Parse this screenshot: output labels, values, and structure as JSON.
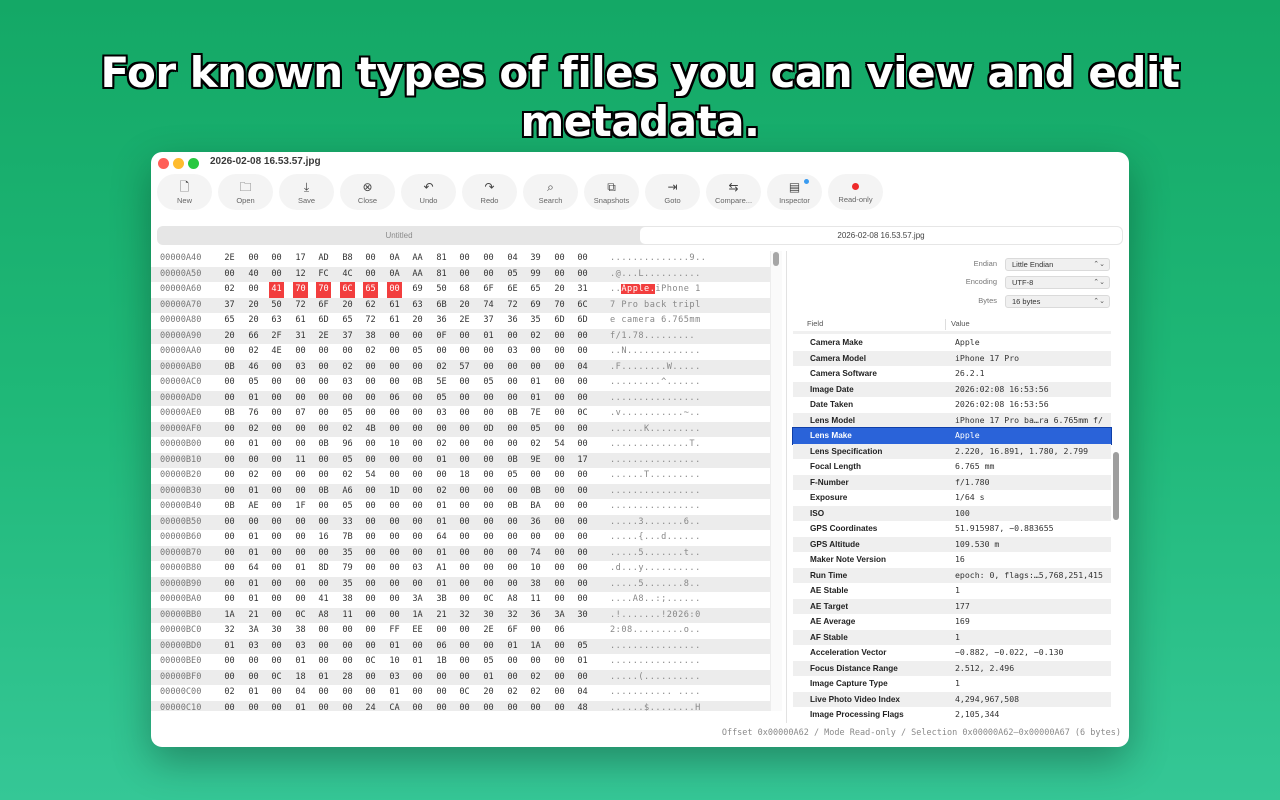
{
  "headline": "For known types of files you can view and edit metadata.",
  "window": {
    "title": "2026-02-08 16.53.57.jpg"
  },
  "toolbar": [
    {
      "label": "New",
      "icon": "new-file-icon"
    },
    {
      "label": "Open",
      "icon": "folder-icon"
    },
    {
      "label": "Save",
      "icon": "save-icon"
    },
    {
      "label": "Close",
      "icon": "close-circle-icon"
    },
    {
      "label": "Undo",
      "icon": "undo-icon"
    },
    {
      "label": "Redo",
      "icon": "redo-icon"
    },
    {
      "label": "Search",
      "icon": "search-icon"
    },
    {
      "label": "Snapshots",
      "icon": "snapshots-icon"
    },
    {
      "label": "Goto",
      "icon": "goto-icon"
    },
    {
      "label": "Compare...",
      "icon": "compare-icon"
    },
    {
      "label": "Inspector",
      "icon": "inspector-icon"
    },
    {
      "label": "Read-only",
      "icon": "record-dot-icon"
    }
  ],
  "tabs": [
    {
      "label": "Untitled",
      "active": false
    },
    {
      "label": "2026-02-08 16.53.57.jpg",
      "active": true
    }
  ],
  "hex_rows": [
    {
      "offset": "00000A40",
      "bytes": [
        "2E",
        "00",
        "00",
        "17",
        "AD",
        "B8",
        "00",
        "0A",
        "AA",
        "81",
        "00",
        "00",
        "04",
        "39",
        "00",
        "00"
      ],
      "ascii": "..............9.."
    },
    {
      "offset": "00000A50",
      "bytes": [
        "00",
        "40",
        "00",
        "12",
        "FC",
        "4C",
        "00",
        "0A",
        "AA",
        "81",
        "00",
        "00",
        "05",
        "99",
        "00",
        "00"
      ],
      "ascii": ".@...L.........."
    },
    {
      "offset": "00000A60",
      "bytes": [
        "02",
        "00",
        "41",
        "70",
        "70",
        "6C",
        "65",
        "00",
        "69",
        "50",
        "68",
        "6F",
        "6E",
        "65",
        "20",
        "31"
      ],
      "ascii_pre": "..",
      "ascii_sel": "Apple.",
      "ascii_post": "iPhone 1",
      "sel": [
        2,
        3,
        4,
        5,
        6,
        7
      ]
    },
    {
      "offset": "00000A70",
      "bytes": [
        "37",
        "20",
        "50",
        "72",
        "6F",
        "20",
        "62",
        "61",
        "63",
        "6B",
        "20",
        "74",
        "72",
        "69",
        "70",
        "6C"
      ],
      "ascii": "7 Pro back tripl"
    },
    {
      "offset": "00000A80",
      "bytes": [
        "65",
        "20",
        "63",
        "61",
        "6D",
        "65",
        "72",
        "61",
        "20",
        "36",
        "2E",
        "37",
        "36",
        "35",
        "6D",
        "6D"
      ],
      "ascii": "e camera 6.765mm"
    },
    {
      "offset": "00000A90",
      "bytes": [
        "20",
        "66",
        "2F",
        "31",
        "2E",
        "37",
        "38",
        "00",
        "00",
        "0F",
        "00",
        "01",
        "00",
        "02",
        "00",
        "00"
      ],
      "ascii": " f/1.78........."
    },
    {
      "offset": "00000AA0",
      "bytes": [
        "00",
        "02",
        "4E",
        "00",
        "00",
        "00",
        "02",
        "00",
        "05",
        "00",
        "00",
        "00",
        "03",
        "00",
        "00",
        "00"
      ],
      "ascii": "..N............."
    },
    {
      "offset": "00000AB0",
      "bytes": [
        "0B",
        "46",
        "00",
        "03",
        "00",
        "02",
        "00",
        "00",
        "00",
        "02",
        "57",
        "00",
        "00",
        "00",
        "00",
        "04"
      ],
      "ascii": ".F........W....."
    },
    {
      "offset": "00000AC0",
      "bytes": [
        "00",
        "05",
        "00",
        "00",
        "00",
        "03",
        "00",
        "00",
        "0B",
        "5E",
        "00",
        "05",
        "00",
        "01",
        "00",
        "00"
      ],
      "ascii": ".........^......"
    },
    {
      "offset": "00000AD0",
      "bytes": [
        "00",
        "01",
        "00",
        "00",
        "00",
        "00",
        "00",
        "06",
        "00",
        "05",
        "00",
        "00",
        "00",
        "01",
        "00",
        "00"
      ],
      "ascii": "................"
    },
    {
      "offset": "00000AE0",
      "bytes": [
        "0B",
        "76",
        "00",
        "07",
        "00",
        "05",
        "00",
        "00",
        "00",
        "03",
        "00",
        "00",
        "0B",
        "7E",
        "00",
        "0C"
      ],
      "ascii": ".v...........~.."
    },
    {
      "offset": "00000AF0",
      "bytes": [
        "00",
        "02",
        "00",
        "00",
        "00",
        "02",
        "4B",
        "00",
        "00",
        "00",
        "00",
        "0D",
        "00",
        "05",
        "00",
        "00"
      ],
      "ascii": "......K........."
    },
    {
      "offset": "00000B00",
      "bytes": [
        "00",
        "01",
        "00",
        "00",
        "0B",
        "96",
        "00",
        "10",
        "00",
        "02",
        "00",
        "00",
        "00",
        "02",
        "54",
        "00"
      ],
      "ascii": "..............T."
    },
    {
      "offset": "00000B10",
      "bytes": [
        "00",
        "00",
        "00",
        "11",
        "00",
        "05",
        "00",
        "00",
        "00",
        "01",
        "00",
        "00",
        "0B",
        "9E",
        "00",
        "17"
      ],
      "ascii": "................"
    },
    {
      "offset": "00000B20",
      "bytes": [
        "00",
        "02",
        "00",
        "00",
        "00",
        "02",
        "54",
        "00",
        "00",
        "00",
        "18",
        "00",
        "05",
        "00",
        "00",
        "00"
      ],
      "ascii": "......T........."
    },
    {
      "offset": "00000B30",
      "bytes": [
        "00",
        "01",
        "00",
        "00",
        "0B",
        "A6",
        "00",
        "1D",
        "00",
        "02",
        "00",
        "00",
        "00",
        "0B",
        "00",
        "00"
      ],
      "ascii": "................"
    },
    {
      "offset": "00000B40",
      "bytes": [
        "0B",
        "AE",
        "00",
        "1F",
        "00",
        "05",
        "00",
        "00",
        "00",
        "01",
        "00",
        "00",
        "0B",
        "BA",
        "00",
        "00"
      ],
      "ascii": "................"
    },
    {
      "offset": "00000B50",
      "bytes": [
        "00",
        "00",
        "00",
        "00",
        "00",
        "33",
        "00",
        "00",
        "00",
        "01",
        "00",
        "00",
        "00",
        "36",
        "00",
        "00"
      ],
      "ascii": ".....3.......6.."
    },
    {
      "offset": "00000B60",
      "bytes": [
        "00",
        "01",
        "00",
        "00",
        "16",
        "7B",
        "00",
        "00",
        "00",
        "64",
        "00",
        "00",
        "00",
        "00",
        "00",
        "00"
      ],
      "ascii": ".....{...d......"
    },
    {
      "offset": "00000B70",
      "bytes": [
        "00",
        "01",
        "00",
        "00",
        "00",
        "35",
        "00",
        "00",
        "00",
        "01",
        "00",
        "00",
        "00",
        "74",
        "00",
        "00"
      ],
      "ascii": ".....5.......t.."
    },
    {
      "offset": "00000B80",
      "bytes": [
        "00",
        "64",
        "00",
        "01",
        "8D",
        "79",
        "00",
        "00",
        "03",
        "A1",
        "00",
        "00",
        "00",
        "10",
        "00",
        "00"
      ],
      "ascii": ".d...y.........."
    },
    {
      "offset": "00000B90",
      "bytes": [
        "00",
        "01",
        "00",
        "00",
        "00",
        "35",
        "00",
        "00",
        "00",
        "01",
        "00",
        "00",
        "00",
        "38",
        "00",
        "00"
      ],
      "ascii": ".....5.......8.."
    },
    {
      "offset": "00000BA0",
      "bytes": [
        "00",
        "01",
        "00",
        "00",
        "41",
        "38",
        "00",
        "00",
        "3A",
        "3B",
        "00",
        "0C",
        "A8",
        "11",
        "00",
        "00"
      ],
      "ascii": "....A8..:;......"
    },
    {
      "offset": "00000BB0",
      "bytes": [
        "1A",
        "21",
        "00",
        "0C",
        "A8",
        "11",
        "00",
        "00",
        "1A",
        "21",
        "32",
        "30",
        "32",
        "36",
        "3A",
        "30"
      ],
      "ascii": ".!.......!2026:0"
    },
    {
      "offset": "00000BC0",
      "bytes": [
        "32",
        "3A",
        "30",
        "38",
        "00",
        "00",
        "00",
        "FF",
        "EE",
        "00",
        "00",
        "2E",
        "6F",
        "00",
        "06"
      ],
      "ascii": "2:08.........o.."
    },
    {
      "offset": "00000BD0",
      "bytes": [
        "01",
        "03",
        "00",
        "03",
        "00",
        "00",
        "00",
        "01",
        "00",
        "06",
        "00",
        "00",
        "01",
        "1A",
        "00",
        "05"
      ],
      "ascii": "................"
    },
    {
      "offset": "00000BE0",
      "bytes": [
        "00",
        "00",
        "00",
        "01",
        "00",
        "00",
        "0C",
        "10",
        "01",
        "1B",
        "00",
        "05",
        "00",
        "00",
        "00",
        "01"
      ],
      "ascii": "................"
    },
    {
      "offset": "00000BF0",
      "bytes": [
        "00",
        "00",
        "0C",
        "18",
        "01",
        "28",
        "00",
        "03",
        "00",
        "00",
        "00",
        "01",
        "00",
        "02",
        "00",
        "00"
      ],
      "ascii": ".....(.........."
    },
    {
      "offset": "00000C00",
      "bytes": [
        "02",
        "01",
        "00",
        "04",
        "00",
        "00",
        "00",
        "01",
        "00",
        "00",
        "0C",
        "20",
        "02",
        "02",
        "00",
        "04"
      ],
      "ascii": "........... ...."
    },
    {
      "offset": "00000C10",
      "bytes": [
        "00",
        "00",
        "00",
        "01",
        "00",
        "00",
        "24",
        "CA",
        "00",
        "00",
        "00",
        "00",
        "00",
        "00",
        "00",
        "48"
      ],
      "ascii": "......$........H"
    }
  ],
  "options": {
    "endian": {
      "label": "Endian",
      "value": "Little Endian"
    },
    "encoding": {
      "label": "Encoding",
      "value": "UTF-8"
    },
    "bytes": {
      "label": "Bytes",
      "value": "16 bytes"
    }
  },
  "table": {
    "field_header": "Field",
    "value_header": "Value"
  },
  "metadata": [
    {
      "field": "Camera Make",
      "value": "Apple"
    },
    {
      "field": "Camera Model",
      "value": "iPhone 17 Pro"
    },
    {
      "field": "Camera Software",
      "value": "26.2.1"
    },
    {
      "field": "Image Date",
      "value": "2026:02:08 16:53:56"
    },
    {
      "field": "Date Taken",
      "value": "2026:02:08 16:53:56"
    },
    {
      "field": "Lens Model",
      "value": "iPhone 17 Pro ba…ra 6.765mm f/"
    },
    {
      "field": "Lens Make",
      "value": "Apple",
      "selected": true
    },
    {
      "field": "Lens Specification",
      "value": "2.220, 16.891, 1.780, 2.799"
    },
    {
      "field": "Focal Length",
      "value": "6.765 mm"
    },
    {
      "field": "F-Number",
      "value": "f/1.780"
    },
    {
      "field": "Exposure",
      "value": "1/64 s"
    },
    {
      "field": "ISO",
      "value": "100"
    },
    {
      "field": "GPS Coordinates",
      "value": "51.915987, −0.883655"
    },
    {
      "field": "GPS Altitude",
      "value": "109.530 m"
    },
    {
      "field": "Maker Note Version",
      "value": "16"
    },
    {
      "field": "Run Time",
      "value": "epoch: 0, flags:…5,768,251,415"
    },
    {
      "field": "AE Stable",
      "value": "1"
    },
    {
      "field": "AE Target",
      "value": "177"
    },
    {
      "field": "AE Average",
      "value": "169"
    },
    {
      "field": "AF Stable",
      "value": "1"
    },
    {
      "field": "Acceleration Vector",
      "value": "−0.882, −0.022, −0.130"
    },
    {
      "field": "Focus Distance Range",
      "value": "2.512, 2.496"
    },
    {
      "field": "Image Capture Type",
      "value": "1"
    },
    {
      "field": "Live Photo Video Index",
      "value": "4,294,967,508"
    },
    {
      "field": "Image Processing Flags",
      "value": "2,105,344"
    }
  ],
  "status": "Offset 0x00000A62 / Mode Read-only / Selection 0x00000A62–0x00000A67 (6 bytes)",
  "colors": {
    "accent": "#2a63d9",
    "selection": "#f23e3e",
    "background": "#1fb878"
  }
}
